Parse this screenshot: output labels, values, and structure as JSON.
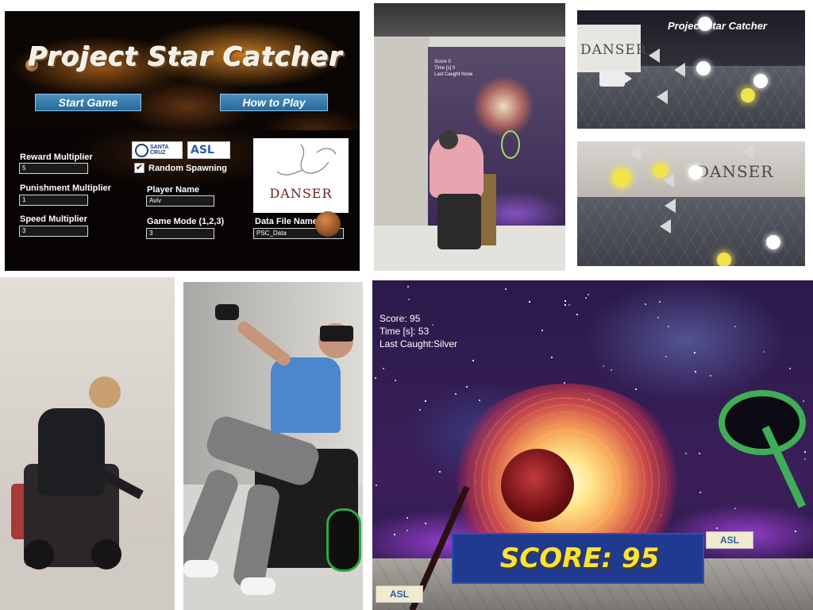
{
  "menu": {
    "title": "Project Star Catcher",
    "start_button": "Start Game",
    "how_button": "How to Play",
    "reward_label": "Reward Multiplier",
    "reward_value": "5",
    "punishment_label": "Punishment Multiplier",
    "punishment_value": "1",
    "speed_label": "Speed Multiplier",
    "speed_value": "3",
    "random_label": "Random Spawning",
    "random_checked": "✔",
    "player_label": "Player Name",
    "player_value": "Aviv",
    "mode_label": "Game Mode (1,2,3)",
    "mode_value": "3",
    "file_label": "Data File Name",
    "file_value": "PSC_Data",
    "logo_ucsc": "SANTA CRUZ",
    "logo_asl": "ASL",
    "danser_logo": "DANSER"
  },
  "room": {
    "hud_lines": [
      "Score 0",
      "Time [s] 0",
      "Last Caught None"
    ]
  },
  "editor_top": {
    "title": "Project Star Catcher",
    "danser": "DANSER"
  },
  "editor_bottom": {
    "danser": "DANSER"
  },
  "game": {
    "score_line": "Score: 95",
    "time_line": "Time [s]: 53",
    "last_line": "Last Caught:Silver",
    "scoreboard": "SCORE: 95",
    "asl_logo": "ASL"
  },
  "colors": {
    "menu_button": "#2a6a9a",
    "scoreboard_bg": "#1f3a8f",
    "scoreboard_text": "#f7e33a",
    "ring_green": "#3fae57"
  }
}
